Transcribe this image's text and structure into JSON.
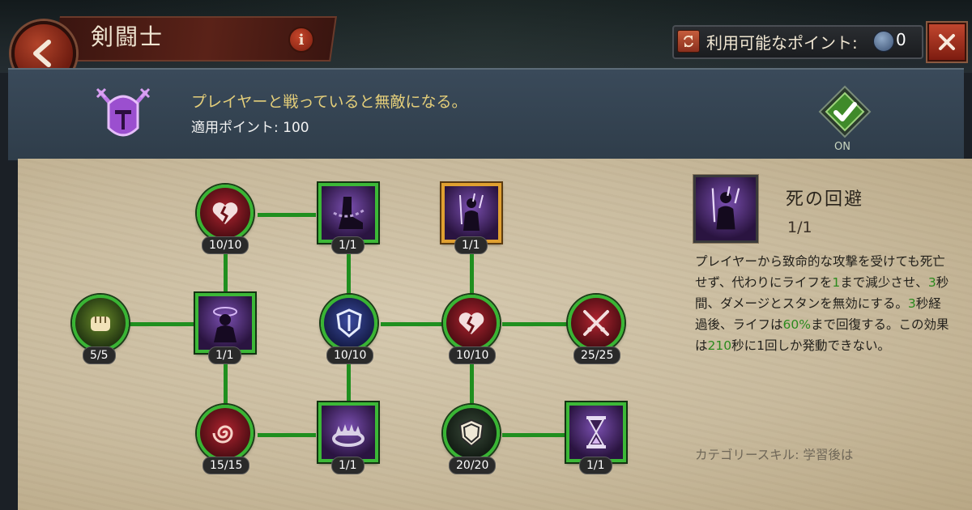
{
  "header": {
    "title": "剣闘士",
    "info_label": "i",
    "points_label": "利用可能なポイント:",
    "points_value": "0"
  },
  "summary": {
    "description": "プレイヤーと戦っていると無敵になる。",
    "applied_points": "適用ポイント: 100",
    "toggle_label": "ON"
  },
  "tree": {
    "nodes": [
      {
        "id": "n-fist",
        "count": "5/5",
        "icon": "fist-icon"
      },
      {
        "id": "n-broken-heart-top",
        "count": "10/10",
        "icon": "broken-heart-icon"
      },
      {
        "id": "n-shadow-figure",
        "count": "1/1",
        "icon": "shadow-figure-icon"
      },
      {
        "id": "n-swirl",
        "count": "15/15",
        "icon": "swirl-icon"
      },
      {
        "id": "n-chained-boot",
        "count": "1/1",
        "icon": "chained-boot-icon"
      },
      {
        "id": "n-blue-shield",
        "count": "10/10",
        "icon": "blue-shield-icon"
      },
      {
        "id": "n-bear-trap",
        "count": "1/1",
        "icon": "bear-trap-icon"
      },
      {
        "id": "n-death-evasion",
        "count": "1/1",
        "icon": "warrior-arrows-icon"
      },
      {
        "id": "n-broken-heart-mid",
        "count": "10/10",
        "icon": "broken-heart-icon"
      },
      {
        "id": "n-white-shield",
        "count": "20/20",
        "icon": "white-shield-icon"
      },
      {
        "id": "n-crossed-swords",
        "count": "25/25",
        "icon": "crossed-swords-icon"
      },
      {
        "id": "n-hourglass",
        "count": "1/1",
        "icon": "hourglass-icon"
      }
    ]
  },
  "detail": {
    "name": "死の回避",
    "level": "1/1",
    "desc": [
      {
        "t": "プレイヤーから致命的な攻撃を受けても死亡せず、代わりにライフを"
      },
      {
        "t": "1",
        "hl": true
      },
      {
        "t": "まで減少させ、"
      },
      {
        "t": "3",
        "hl": true
      },
      {
        "t": "秒間、ダメージとスタンを無効にする。"
      },
      {
        "t": "3",
        "hl": true
      },
      {
        "t": "秒経過後、ライフは"
      },
      {
        "t": "60%",
        "hl": true
      },
      {
        "t": "まで回復する。この効果は"
      },
      {
        "t": "210",
        "hl": true
      },
      {
        "t": "秒に1回しか発動できない。"
      }
    ],
    "category": "カテゴリースキル: 学習後は"
  },
  "colors": {
    "accent_green": "#39b534",
    "highlight_text": "#2c8a1e",
    "desc_gold": "#e5cf7a"
  }
}
